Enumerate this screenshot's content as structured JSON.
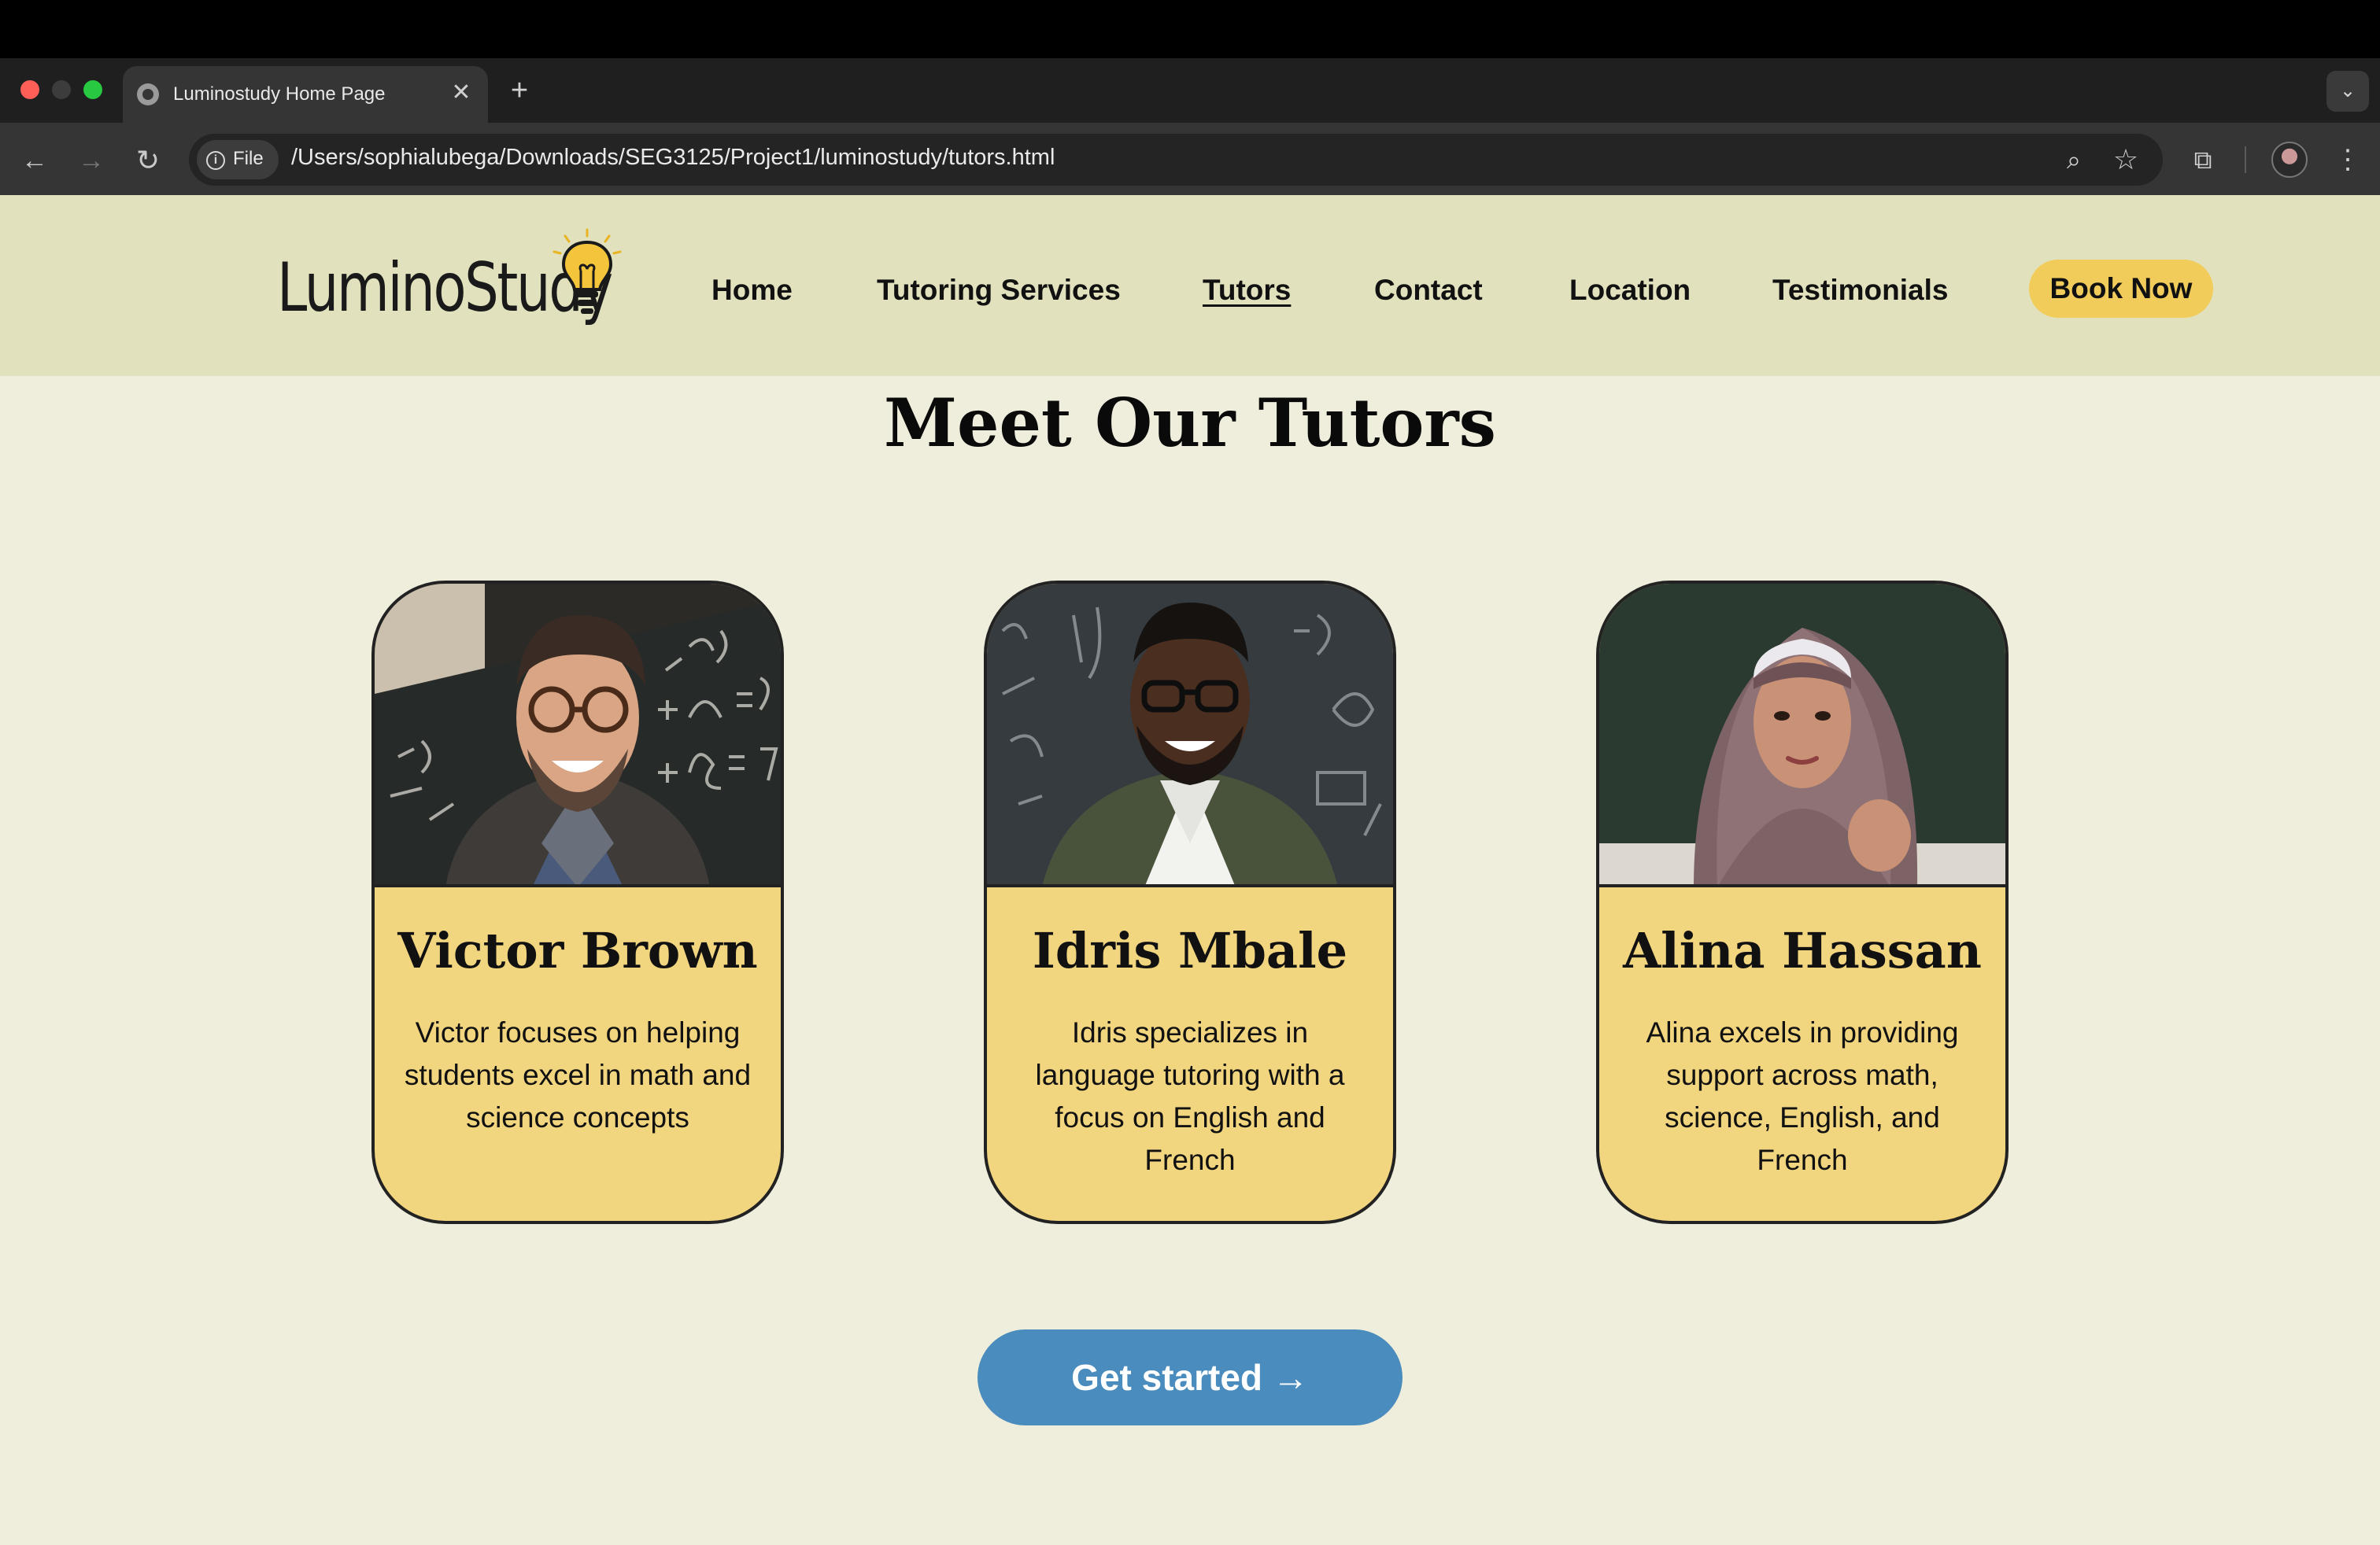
{
  "browser": {
    "tab_title": "Luminostudy Home Page",
    "tab_close": "✕",
    "new_tab": "+",
    "tab_menu": "⌄",
    "back": "←",
    "forward": "→",
    "reload": "↻",
    "file_chip": "File",
    "url": "/Users/sophialubega/Downloads/SEG3125/Project1/luminostudy/tutors.html",
    "zoom_icon": "⌕",
    "star_icon": "☆",
    "extensions_icon": "⧉",
    "menu_icon": "⋮"
  },
  "site": {
    "logo": "LuminoStudy",
    "nav": [
      {
        "label": "Home"
      },
      {
        "label": "Tutoring Services"
      },
      {
        "label": "Tutors"
      },
      {
        "label": "Contact"
      },
      {
        "label": "Location"
      },
      {
        "label": "Testimonials"
      }
    ],
    "active_nav": "Tutors",
    "book_now": "Book Now",
    "accent_color": "#f1cc5b",
    "header_color": "#e2e1bd",
    "background_color": "#efeedc"
  },
  "main": {
    "title": "Meet Our Tutors",
    "tutors": [
      {
        "name": "Victor Brown",
        "description": "Victor focuses on helping students excel in math and science concepts"
      },
      {
        "name": "Idris Mbale",
        "description": "Idris specializes in language tutoring with a focus on English and French"
      },
      {
        "name": "Alina Hassan",
        "description": "Alina excels in providing support across math, science, English, and French"
      }
    ],
    "cta": "Get started →",
    "cta_color": "#4a8cbd"
  }
}
